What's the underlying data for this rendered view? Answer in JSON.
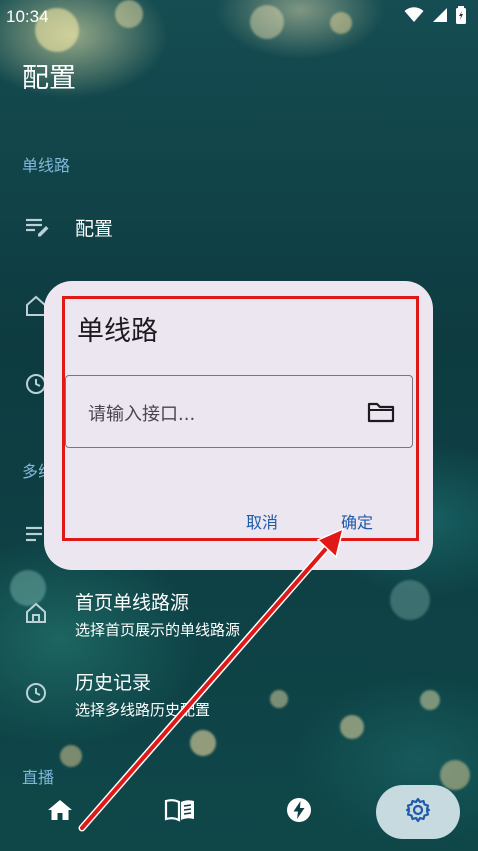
{
  "status_bar": {
    "time": "10:34",
    "icons": [
      "wifi-icon",
      "signal-icon",
      "battery-icon"
    ]
  },
  "page": {
    "title": "配置"
  },
  "sections": [
    {
      "label": "单线路",
      "items": [
        {
          "icon": "edit-list-icon",
          "title": "配置"
        }
      ]
    },
    {
      "label": "多线路",
      "items": [
        {
          "icon": "list-icon",
          "title": ""
        },
        {
          "icon": "home-icon",
          "title": "首页单线路源",
          "subtitle": "选择首页展示的单线路源"
        },
        {
          "icon": "history-icon",
          "title": "历史记录",
          "subtitle": "选择多线路历史配置"
        }
      ]
    },
    {
      "label": "直播"
    }
  ],
  "dialog": {
    "title": "单线路",
    "input_placeholder": "请输入接口...",
    "cancel_label": "取消",
    "confirm_label": "确定"
  },
  "bottom_nav": [
    {
      "icon": "home-icon",
      "active": false
    },
    {
      "icon": "book-icon",
      "active": false
    },
    {
      "icon": "lightning-icon",
      "active": false
    },
    {
      "icon": "gear-icon",
      "active": true
    }
  ],
  "colors": {
    "dialog_bg": "#ece6f0",
    "accent_text": "#1e5aa8",
    "highlight": "#e01818",
    "section_label": "#7fb8d8"
  }
}
